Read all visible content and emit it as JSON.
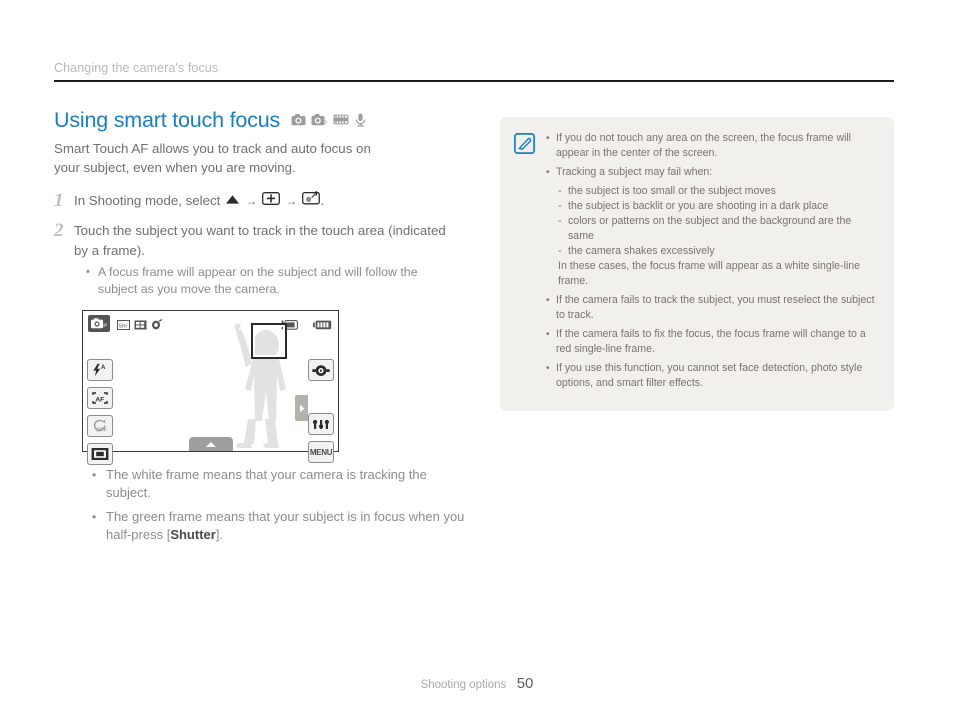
{
  "running_header": {
    "text": "Changing the camera's focus"
  },
  "section": {
    "title": "Using smart touch focus",
    "mode_icons": [
      "camera-icon",
      "camera-program-icon",
      "movie-icon",
      "voice-recorder-icon"
    ],
    "intro": "Smart Touch AF allows you to track and auto focus on your subject, even when you are moving."
  },
  "steps": [
    {
      "number": "1",
      "text_before": "In Shooting mode, select",
      "icons": [
        "triangle-up-icon",
        "plus-box-icon",
        "smart-touch-af-icon"
      ],
      "text_after": ".",
      "arrow": "→"
    },
    {
      "number": "2",
      "text": "Touch the subject you want to track in the touch area (indicated by a frame).",
      "bullets": [
        "A focus frame will appear on the subject and will follow the subject as you move the camera."
      ]
    }
  ],
  "lcd": {
    "mode_badge": "mode-program-icon",
    "top_icons": [
      "resolution-icon",
      "burst-icon",
      "metering-icon"
    ],
    "top_right_icons": [
      "memory-card-icon",
      "battery-icon"
    ],
    "left_buttons": [
      "flash-auto-icon",
      "auto-focus-icon",
      "timer-off-icon",
      "display-icon"
    ],
    "right_buttons": [
      "ev-dial-icon",
      "adjust-icon"
    ],
    "menu_label": "MENU",
    "side_tab": "tab-arrow-right-icon",
    "bottom_tab": "tab-arrow-up-icon",
    "focus_frame": "focus-frame"
  },
  "figure_bullets": [
    {
      "pre": "The white frame means that your camera is tracking the subject.",
      "bold": "",
      "post": ""
    },
    {
      "pre": "The green frame means that your subject is in focus when you half-press [",
      "bold": "Shutter",
      "post": "]."
    }
  ],
  "note": {
    "icon": "note-pen-icon",
    "items": [
      "If you do not touch any area on the screen, the focus frame will appear in the center of the screen.",
      "Tracking a subject may fail when:"
    ],
    "sub_items": [
      "the subject is too small or the subject moves",
      "the subject is backlit or you are shooting in a dark place",
      "colors or patterns on the subject and the background are the same",
      "the camera shakes excessively"
    ],
    "plain_text": "In these cases, the focus frame will appear as a white single-line frame.",
    "items_after": [
      "If the camera fails to track the subject, you must reselect the subject to track.",
      "If the camera fails to fix the focus, the focus frame will change to a red single-line frame.",
      "If you use this function, you cannot set face detection, photo style options, and smart filter effects."
    ],
    "bullet_char": "•",
    "dash_char": "-"
  },
  "footer": {
    "label": "Shooting options",
    "page": "50"
  },
  "colors": {
    "heading_blue": "#1a7ec4",
    "note_bg": "#f2f0ec",
    "body_grey": "#6f6f6f"
  }
}
